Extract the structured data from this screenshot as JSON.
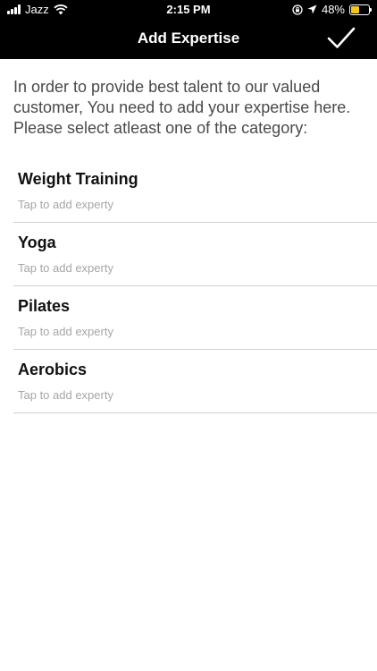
{
  "status_bar": {
    "carrier": "Jazz",
    "time": "2:15 PM",
    "battery_percent": "48%",
    "battery_level": 0.48,
    "battery_color": "#f5c518",
    "icons": [
      "signal-icon",
      "wifi-icon",
      "screen-lock-icon",
      "location-icon",
      "battery-icon"
    ]
  },
  "nav": {
    "title": "Add Expertise",
    "done_icon": "checkmark-icon"
  },
  "intro_text": "In order to provide best talent to our valued customer, You need to add your expertise here. Please select atleast one of the category:",
  "categories": [
    {
      "title": "Weight Training",
      "subtitle": "Tap to add experty"
    },
    {
      "title": "Yoga",
      "subtitle": "Tap to add experty"
    },
    {
      "title": "Pilates",
      "subtitle": "Tap to add experty"
    },
    {
      "title": "Aerobics",
      "subtitle": "Tap to add experty"
    }
  ]
}
